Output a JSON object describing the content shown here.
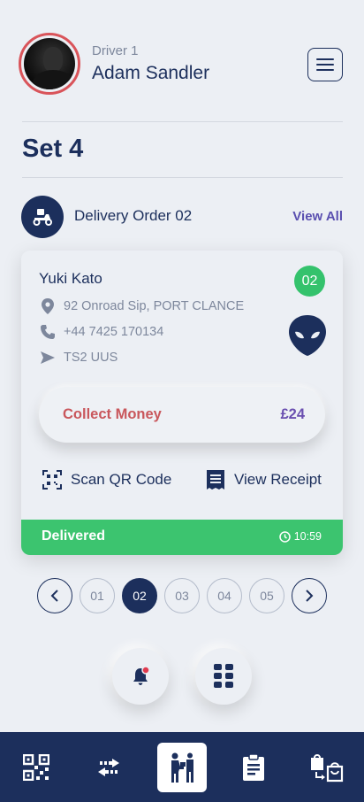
{
  "header": {
    "driver_label": "Driver 1",
    "driver_name": "Adam Sandler",
    "avatar_border_color": "#d9545a"
  },
  "set_title": "Set 4",
  "order": {
    "label": "Delivery Order 02",
    "view_all": "View All",
    "icon": "scooter-icon"
  },
  "card": {
    "customer_name": "Yuki Kato",
    "order_number": "02",
    "address": "92 Onroad Sip, PORT CLANCE",
    "phone": "+44 7425 170134",
    "postcode": "TS2 UUS",
    "collect_label": "Collect Money",
    "collect_amount": "£24",
    "scan_label": "Scan QR Code",
    "receipt_label": "View Receipt",
    "status": "Delivered",
    "status_color": "#3cc46f",
    "time": "10:59"
  },
  "pagination": {
    "pages": [
      "01",
      "02",
      "03",
      "04",
      "05"
    ],
    "active": "02"
  },
  "bottom_nav": {
    "items": [
      "qr-scan-icon",
      "transfer-icon",
      "delivery-person-icon",
      "clipboard-icon",
      "bags-transfer-icon"
    ],
    "active": "delivery-person-icon"
  },
  "colors": {
    "primary": "#1c2f5c",
    "background": "#eceff4",
    "accent_purple": "#5a4fb0",
    "money_red": "#c9575c",
    "success_green": "#34c26c"
  }
}
